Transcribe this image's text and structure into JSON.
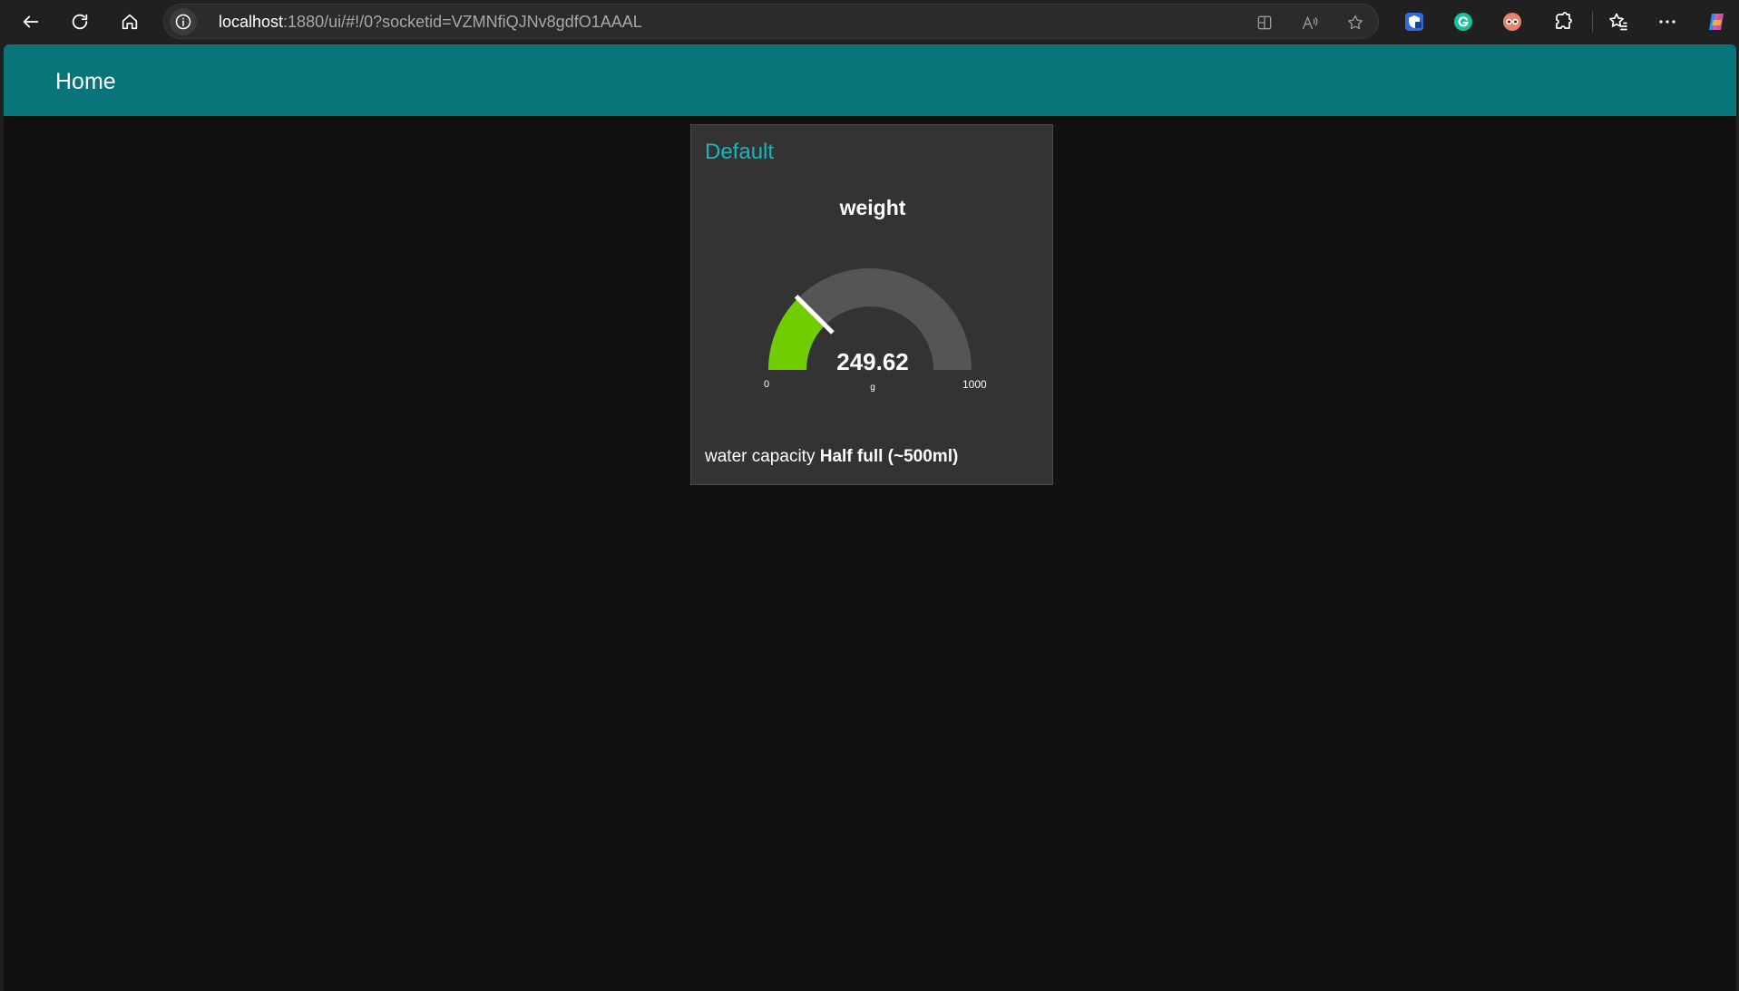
{
  "browser": {
    "url_host": "localhost",
    "url_rest": ":1880/ui/#!/0?socketid=VZMNfiQJNv8gdfO1AAAL"
  },
  "header": {
    "title": "Home"
  },
  "group": {
    "title": "Default"
  },
  "gauge": {
    "label": "weight",
    "value": "249.62",
    "units": "g",
    "min_label": "0",
    "max_label": "1000",
    "fraction": 0.2496
  },
  "text_widget": {
    "label": "water capacity",
    "value": "Half full (~500ml)"
  },
  "colors": {
    "header": "#097479",
    "group_title": "#1bb6bf",
    "gauge_fill": "#6fcd00",
    "gauge_track": "#555555",
    "page_background": "#111111",
    "card_background": "#333333"
  },
  "icons": {
    "back": "back-arrow-icon",
    "refresh": "refresh-icon",
    "home": "home-icon",
    "site_info": "info-icon",
    "split_screen": "split-screen-icon",
    "read_aloud": "read-aloud-icon",
    "favorite": "star-icon",
    "extensions": [
      "shield-extension-icon",
      "grammarly-icon",
      "eyes-extension-icon",
      "puzzle-extensions-icon"
    ],
    "favorites": "favorites-icon",
    "more": "more-icon",
    "copilot": "copilot-icon"
  }
}
